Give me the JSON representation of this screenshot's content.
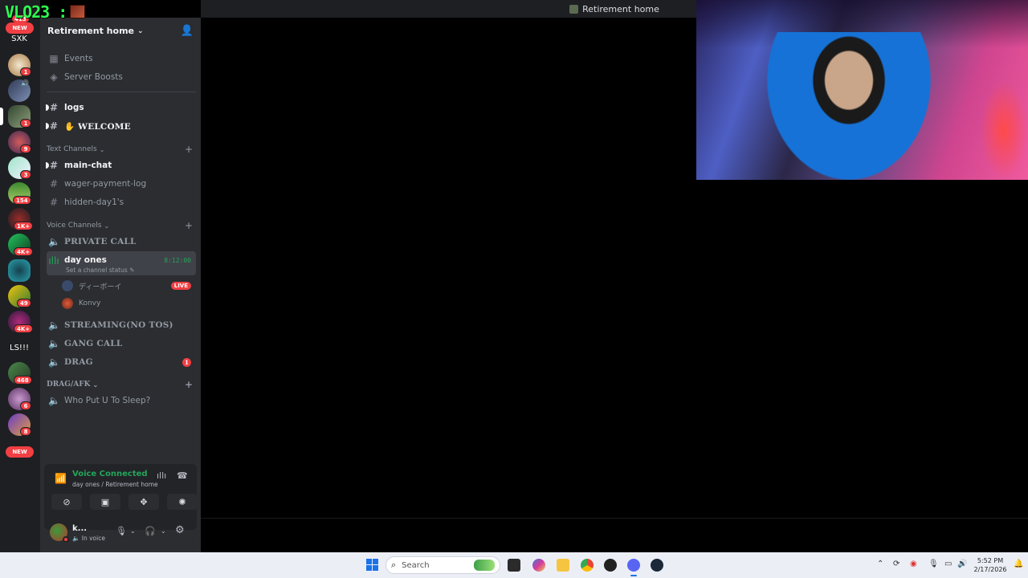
{
  "overlay": {
    "tag": "VLO23 :"
  },
  "window": {
    "title": "Retirement home"
  },
  "server_rail": {
    "items": [
      {
        "label": "SXK",
        "badge": ""
      },
      {
        "badge": "1"
      },
      {
        "badge": ""
      },
      {
        "badge": "1"
      },
      {
        "badge": "9"
      },
      {
        "badge": "3"
      },
      {
        "badge": "154"
      },
      {
        "badge": "1K+"
      },
      {
        "badge": "4K+"
      },
      {
        "badge": ""
      },
      {
        "badge": "49"
      },
      {
        "badge": "4K+"
      },
      {
        "label": "LS!!!",
        "badge": ""
      },
      {
        "badge": "468"
      },
      {
        "badge": "6"
      },
      {
        "badge": "8"
      }
    ],
    "new_top": "NEW",
    "new_bottom": "NEW",
    "partial_badge": "413"
  },
  "sidebar": {
    "server_name": "Retirement home",
    "top_items": [
      {
        "label": "Events",
        "icon": "calendar-icon"
      },
      {
        "label": "Server Boosts",
        "icon": "boost-icon"
      }
    ],
    "pinned_channels": [
      {
        "label": "logs"
      },
      {
        "label": "✋ WELCOME"
      }
    ],
    "text_category": "Text Channels",
    "text_channels": [
      {
        "label": "main-chat"
      },
      {
        "label": "wager-payment-log"
      },
      {
        "label": "hidden-day1's"
      }
    ],
    "voice_category": "Voice Channels",
    "voice_channels": {
      "private": "PRIVATE CALL",
      "active": {
        "label": "day ones",
        "timer": "8:12:00",
        "status": "Set a channel status"
      },
      "users": [
        {
          "name": "ディーボーイ",
          "live": "LIVE"
        },
        {
          "name": "Konvy"
        }
      ],
      "streaming": "STREAMING(NO TOS)",
      "gang": "GANG CALL",
      "drag": "DRAG",
      "drag_mentions": "1"
    },
    "afk_category": "DRAG/AFK",
    "afk_channel": "Who Put U To Sleep?"
  },
  "voice_panel": {
    "title": "Voice Connected",
    "subtitle": "day ones / Retirement home"
  },
  "user_panel": {
    "name": "k...",
    "status": "In voice"
  },
  "taskbar": {
    "search_placeholder": "Search",
    "time": "5:52 PM",
    "date": "2/17/2026"
  },
  "colors": {
    "online_green": "#23a55a",
    "mention_red": "#f23f43",
    "overlay_green": "#2dff52"
  }
}
